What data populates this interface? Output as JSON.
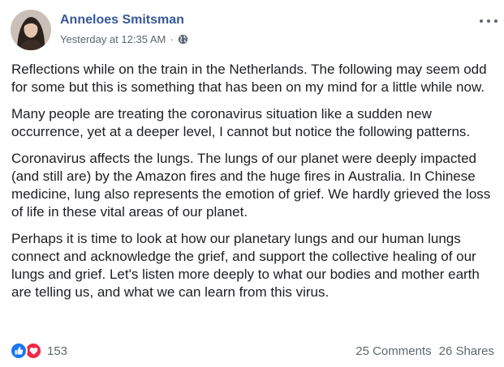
{
  "post": {
    "author": "Anneloes Smitsman",
    "timestamp": "Yesterday at 12:35 AM",
    "separator": "·",
    "privacy_icon": "globe-icon",
    "paragraphs": [
      "Reflections while on the train in the Netherlands. The following may seem odd for some but this is something that has been on my mind for a little while now.",
      "Many people are treating the coronavirus situation like a sudden new occurrence, yet at a deeper level, I cannot but notice the following patterns.",
      "Coronavirus affects the lungs. The lungs of our planet were deeply impacted (and still are) by the Amazon fires and the huge fires in Australia. In Chinese medicine, lung also represents the emotion of grief. We hardly grieved the loss of life in these vital areas of our planet.",
      "Perhaps it is time to look at how our planetary lungs and our human lungs connect and acknowledge the grief, and support the collective healing of our lungs and grief. Let's listen more deeply to what our bodies and mother earth are telling us, and what we can learn from this virus."
    ]
  },
  "footer": {
    "reaction_icons": [
      "like-icon",
      "love-icon"
    ],
    "reaction_count": "153",
    "comments": "25 Comments",
    "shares": "26 Shares"
  },
  "colors": {
    "author": "#385898",
    "like": "#1877f2",
    "love": "#f02849",
    "meta": "#606770"
  }
}
